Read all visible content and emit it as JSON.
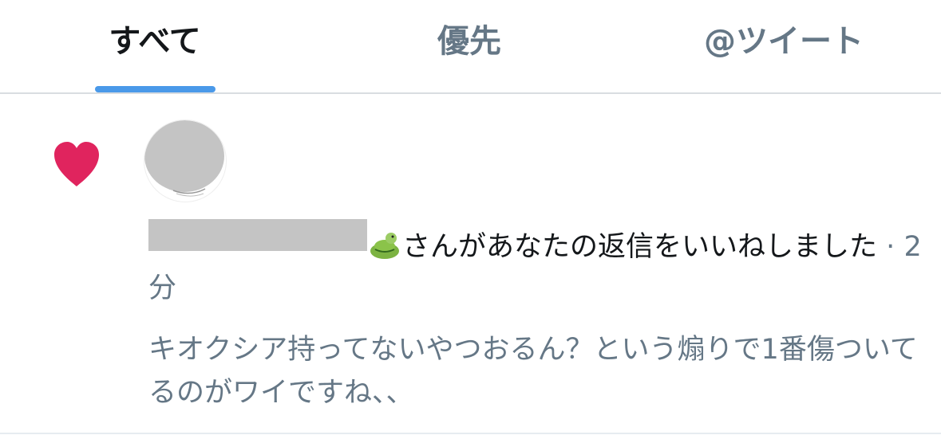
{
  "tabs": {
    "all": "すべて",
    "priority": "優先",
    "mentions": "@ツイート"
  },
  "notification": {
    "icon": "heart-icon",
    "action_text": "さんがあなたの返信をいいねしました",
    "separator": "·",
    "time": "2分",
    "tweet_text": "キオクシア持ってないやつおるん？という煽りで1番傷ついてるのがワイですね、、"
  },
  "colors": {
    "heart": "#e0245e",
    "accent": "#4a99e9",
    "text_primary": "#14171a",
    "text_secondary": "#657786"
  }
}
